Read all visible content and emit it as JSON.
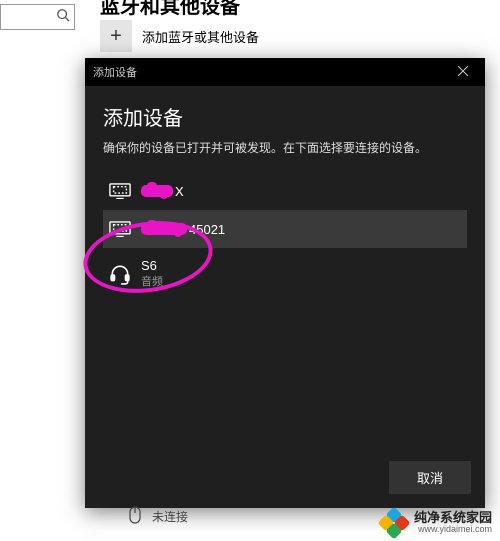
{
  "background": {
    "page_header_partial": "蓝牙和其他设备",
    "add_device_label": "添加蓝牙或其他设备",
    "bottom_status": "未连接"
  },
  "dialog": {
    "titlebar": "添加设备",
    "heading": "添加设备",
    "subtext": "确保你的设备已打开并可被发现。在下面选择要连接的设备。",
    "devices": [
      {
        "name_redacted_prefix": true,
        "name_suffix": "X",
        "type": "",
        "icon": "display-icon",
        "selected": false
      },
      {
        "name_redacted_prefix": true,
        "name_suffix": "45021",
        "type": "",
        "icon": "display-icon",
        "selected": true
      },
      {
        "name_redacted_prefix": false,
        "name": "S6",
        "type": "音频",
        "icon": "headset-icon",
        "selected": false
      }
    ],
    "cancel_label": "取消"
  },
  "watermark": {
    "brand": "纯净系统家园",
    "url": "www.yidaimei.com"
  }
}
